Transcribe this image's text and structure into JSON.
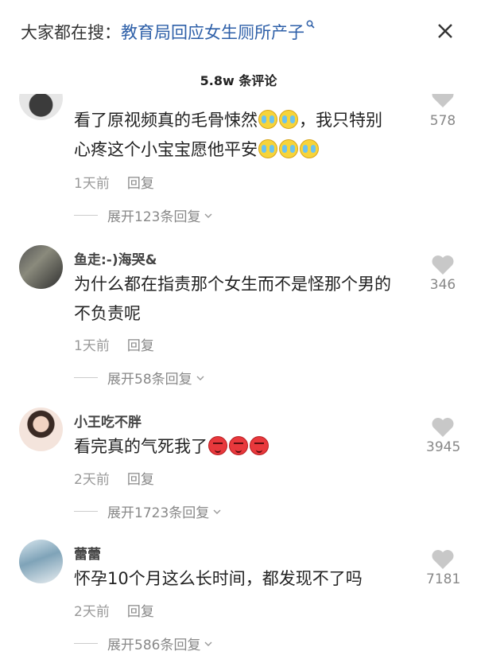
{
  "header": {
    "search_prefix": "大家都在搜：",
    "search_query": "教育局回应女生厕所产子",
    "search_icon": "search-icon",
    "close_icon": "close-icon"
  },
  "comment_count_title": "5.8w 条评论",
  "comments": [
    {
      "username": "",
      "line1": "看了原视频真的毛骨悚然",
      "line1_after": "，我只特别",
      "line2": "心疼这个小宝宝愿他平安",
      "emoji_line1": [
        "crying-emoji",
        "crying-emoji"
      ],
      "emoji_line2": [
        "crying-emoji",
        "crying-emoji",
        "crying-emoji"
      ],
      "time": "1天前",
      "reply": "回复",
      "expand": "展开123条回复",
      "likes": "578"
    },
    {
      "username": "鱼走:-)海哭&",
      "line1": "为什么都在指责那个女生而不是怪那个男的",
      "line2": "不负责呢",
      "time": "1天前",
      "reply": "回复",
      "expand": "展开58条回复",
      "likes": "346"
    },
    {
      "username": "小王吃不胖",
      "line1": "看完真的气死我了",
      "emoji_line1": [
        "angry-emoji",
        "angry-emoji",
        "angry-emoji"
      ],
      "time": "2天前",
      "reply": "回复",
      "expand": "展开1723条回复",
      "likes": "3945"
    },
    {
      "username": "蕾蕾",
      "line1": "怀孕10个月这么长时间，都发现不了吗",
      "time": "2天前",
      "reply": "回复",
      "expand": "展开586条回复",
      "likes": "7181"
    }
  ],
  "colors": {
    "link_blue": "#2d5fa8",
    "meta_gray": "#999999",
    "like_gray": "#c8c8c8"
  }
}
